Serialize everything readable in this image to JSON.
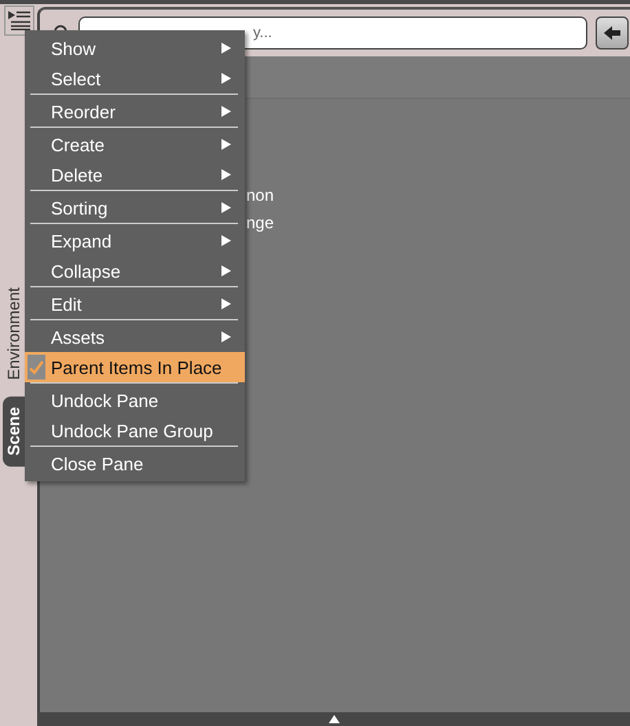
{
  "side_tabs": [
    {
      "label": "Environment",
      "selected": false
    },
    {
      "label": "Scene",
      "selected": true
    }
  ],
  "search": {
    "placeholder": "y..."
  },
  "list": [
    "non",
    "nge"
  ],
  "menu": {
    "groups": [
      [
        {
          "label": "Show",
          "has_submenu": true,
          "checked": false,
          "selected": false
        },
        {
          "label": "Select",
          "has_submenu": true,
          "checked": false,
          "selected": false
        }
      ],
      [
        {
          "label": "Reorder",
          "has_submenu": true,
          "checked": false,
          "selected": false
        }
      ],
      [
        {
          "label": "Create",
          "has_submenu": true,
          "checked": false,
          "selected": false
        },
        {
          "label": "Delete",
          "has_submenu": true,
          "checked": false,
          "selected": false
        }
      ],
      [
        {
          "label": "Sorting",
          "has_submenu": true,
          "checked": false,
          "selected": false
        }
      ],
      [
        {
          "label": "Expand",
          "has_submenu": true,
          "checked": false,
          "selected": false
        },
        {
          "label": "Collapse",
          "has_submenu": true,
          "checked": false,
          "selected": false
        }
      ],
      [
        {
          "label": "Edit",
          "has_submenu": true,
          "checked": false,
          "selected": false
        }
      ],
      [
        {
          "label": "Assets",
          "has_submenu": true,
          "checked": false,
          "selected": false
        },
        {
          "label": "Parent Items In Place",
          "has_submenu": false,
          "checked": true,
          "selected": true
        }
      ],
      [
        {
          "label": "Undock Pane",
          "has_submenu": false,
          "checked": false,
          "selected": false
        },
        {
          "label": "Undock Pane Group",
          "has_submenu": false,
          "checked": false,
          "selected": false
        }
      ],
      [
        {
          "label": "Close Pane",
          "has_submenu": false,
          "checked": false,
          "selected": false
        }
      ]
    ]
  }
}
